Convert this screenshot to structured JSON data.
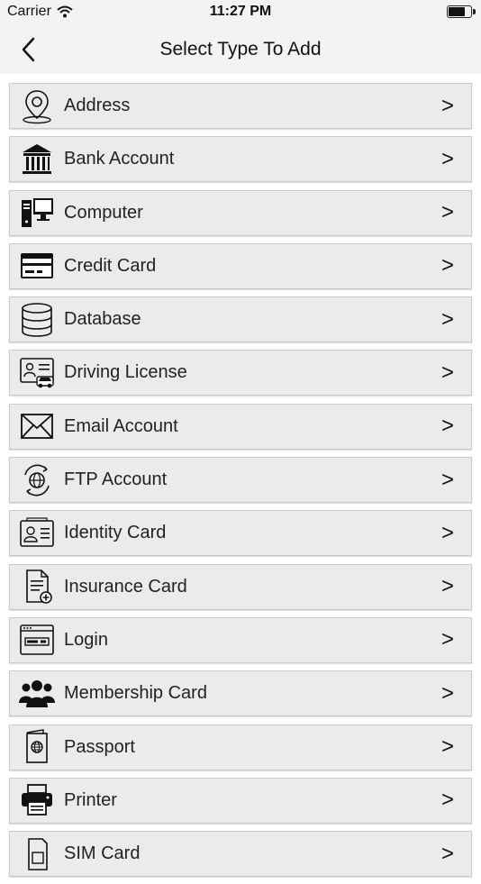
{
  "status_bar": {
    "carrier": "Carrier",
    "time": "11:27 PM"
  },
  "nav": {
    "title": "Select Type To Add",
    "back_icon": "chevron-left-icon"
  },
  "items": [
    {
      "label": "Address",
      "icon": "location-pin-icon",
      "chevron": ">"
    },
    {
      "label": "Bank Account",
      "icon": "bank-icon",
      "chevron": ">"
    },
    {
      "label": "Computer",
      "icon": "computer-icon",
      "chevron": ">"
    },
    {
      "label": "Credit Card",
      "icon": "credit-card-icon",
      "chevron": ">"
    },
    {
      "label": "Database",
      "icon": "database-icon",
      "chevron": ">"
    },
    {
      "label": "Driving License",
      "icon": "driving-license-icon",
      "chevron": ">"
    },
    {
      "label": "Email Account",
      "icon": "envelope-icon",
      "chevron": ">"
    },
    {
      "label": "FTP Account",
      "icon": "ftp-globe-icon",
      "chevron": ">"
    },
    {
      "label": "Identity Card",
      "icon": "id-card-icon",
      "chevron": ">"
    },
    {
      "label": "Insurance Card",
      "icon": "insurance-document-icon",
      "chevron": ">"
    },
    {
      "label": "Login",
      "icon": "login-window-icon",
      "chevron": ">"
    },
    {
      "label": "Membership Card",
      "icon": "people-group-icon",
      "chevron": ">"
    },
    {
      "label": "Passport",
      "icon": "passport-icon",
      "chevron": ">"
    },
    {
      "label": "Printer",
      "icon": "printer-icon",
      "chevron": ">"
    },
    {
      "label": "SIM Card",
      "icon": "sim-card-icon",
      "chevron": ">"
    }
  ]
}
